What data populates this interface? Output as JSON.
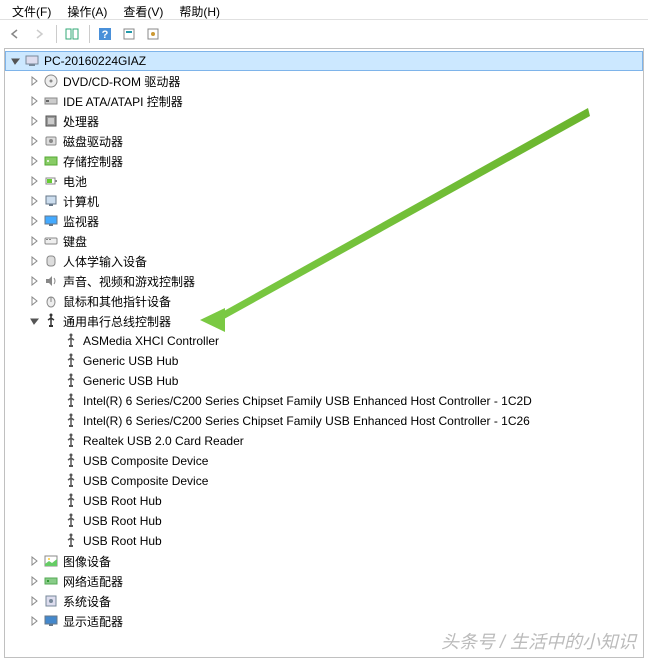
{
  "menu": {
    "file": "文件(F)",
    "action": "操作(A)",
    "view": "查看(V)",
    "help": "帮助(H)"
  },
  "root": {
    "label": "PC-20160224GIAZ"
  },
  "categories": [
    {
      "label": "DVD/CD-ROM 驱动器",
      "icon": "disc"
    },
    {
      "label": "IDE ATA/ATAPI 控制器",
      "icon": "ide"
    },
    {
      "label": "处理器",
      "icon": "cpu"
    },
    {
      "label": "磁盘驱动器",
      "icon": "disk"
    },
    {
      "label": "存储控制器",
      "icon": "storage"
    },
    {
      "label": "电池",
      "icon": "battery"
    },
    {
      "label": "计算机",
      "icon": "computer"
    },
    {
      "label": "监视器",
      "icon": "monitor"
    },
    {
      "label": "键盘",
      "icon": "keyboard"
    },
    {
      "label": "人体学输入设备",
      "icon": "hid"
    },
    {
      "label": "声音、视频和游戏控制器",
      "icon": "sound"
    },
    {
      "label": "鼠标和其他指针设备",
      "icon": "mouse"
    },
    {
      "label": "通用串行总线控制器",
      "icon": "usb",
      "expanded": true
    },
    {
      "label": "图像设备",
      "icon": "image"
    },
    {
      "label": "网络适配器",
      "icon": "network"
    },
    {
      "label": "系统设备",
      "icon": "system"
    },
    {
      "label": "显示适配器",
      "icon": "display"
    }
  ],
  "usb_children": [
    "ASMedia XHCI Controller",
    "Generic USB Hub",
    "Generic USB Hub",
    "Intel(R) 6 Series/C200 Series Chipset Family USB Enhanced Host Controller - 1C2D",
    "Intel(R) 6 Series/C200 Series Chipset Family USB Enhanced Host Controller - 1C26",
    "Realtek USB 2.0 Card Reader",
    "USB Composite Device",
    "USB Composite Device",
    "USB Root Hub",
    "USB Root Hub",
    "USB Root Hub"
  ],
  "watermark": "头条号 / 生活中的小知识"
}
